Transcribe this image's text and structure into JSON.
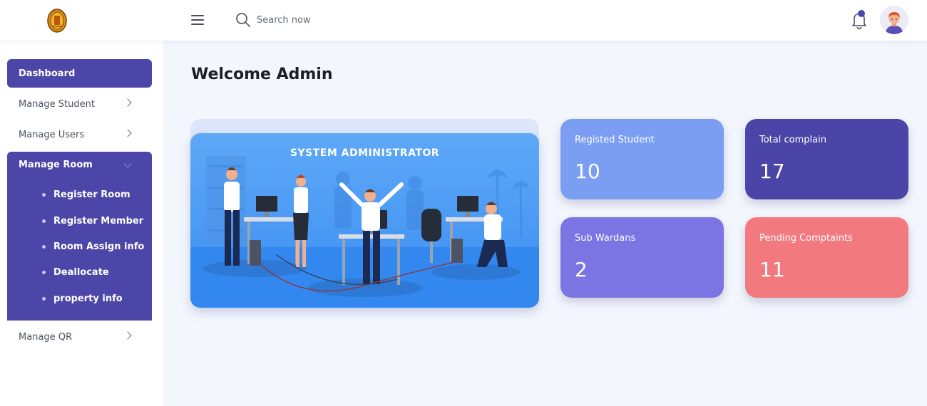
{
  "topbar": {
    "search_placeholder": "Search now"
  },
  "sidebar": {
    "items": [
      {
        "label": "Dashboard"
      },
      {
        "label": "Manage Student"
      },
      {
        "label": "Manage Users"
      },
      {
        "label": "Manage Room"
      },
      {
        "label": "Manage QR"
      }
    ],
    "room_submenu": [
      {
        "label": "Register Room"
      },
      {
        "label": "Register Member"
      },
      {
        "label": "Room Assign info"
      },
      {
        "label": "Deallocate"
      },
      {
        "label": "property info"
      }
    ]
  },
  "main": {
    "welcome": "Welcome Admin",
    "hero_title": "SYSTEM ADMINISTRATOR",
    "cards": [
      {
        "label": "Registed Student",
        "value": "10",
        "color": "#7b9ef3"
      },
      {
        "label": "Total complain",
        "value": "17",
        "color": "#4a45a6"
      },
      {
        "label": "Sub Wardans",
        "value": "2",
        "color": "#7a75e3"
      },
      {
        "label": "Pending Comptaints",
        "value": "11",
        "color": "#f27a7f"
      }
    ]
  },
  "colors": {
    "primary": "#4c46a8",
    "background": "#f3f6fd"
  }
}
